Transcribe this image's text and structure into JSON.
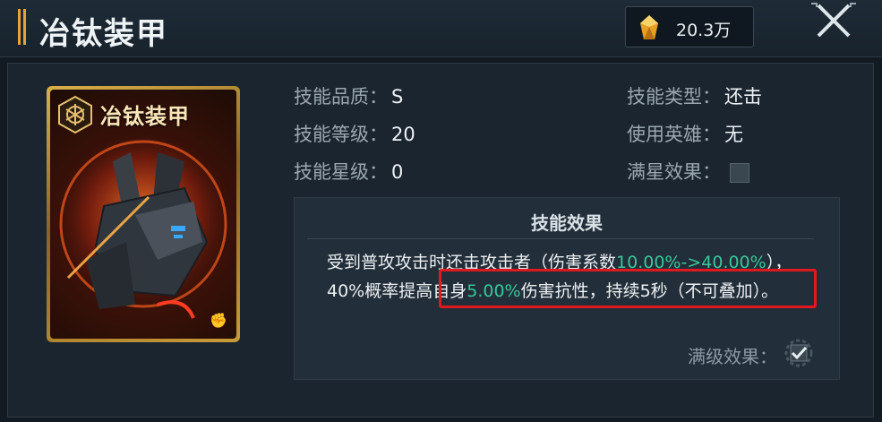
{
  "header": {
    "title": "冶钛装甲",
    "currency_amount": "20.3万",
    "currency_icon": "amber-crystal-icon",
    "close_icon": "close-icon"
  },
  "card": {
    "name": "冶钛装甲",
    "emblem_icon": "hexagon-emblem-icon",
    "type_icon": "fist-icon"
  },
  "info": {
    "quality_label": "技能品质：",
    "quality_value": "S",
    "level_label": "技能等级：",
    "level_value": "20",
    "star_label": "技能星级：",
    "star_value": "0",
    "type_label": "技能类型：",
    "type_value": "还击",
    "hero_label": "使用英雄：",
    "hero_value": "无",
    "fullstar_label": "满星效果："
  },
  "effect": {
    "title": "技能效果",
    "text_part1": "受到普攻攻击时还击攻击者（伤害系数",
    "text_green1": "10.00%->40.00%",
    "text_part2": "），40%概率提高自身",
    "text_green2": "5.00%",
    "text_part3": "伤害抗性，持续5秒（不可叠加）。",
    "maxlevel_label": "满级效果："
  },
  "colors": {
    "accent_green": "#39c79a",
    "highlight_red": "#e0191e",
    "card_gold": "#d9b04a"
  }
}
